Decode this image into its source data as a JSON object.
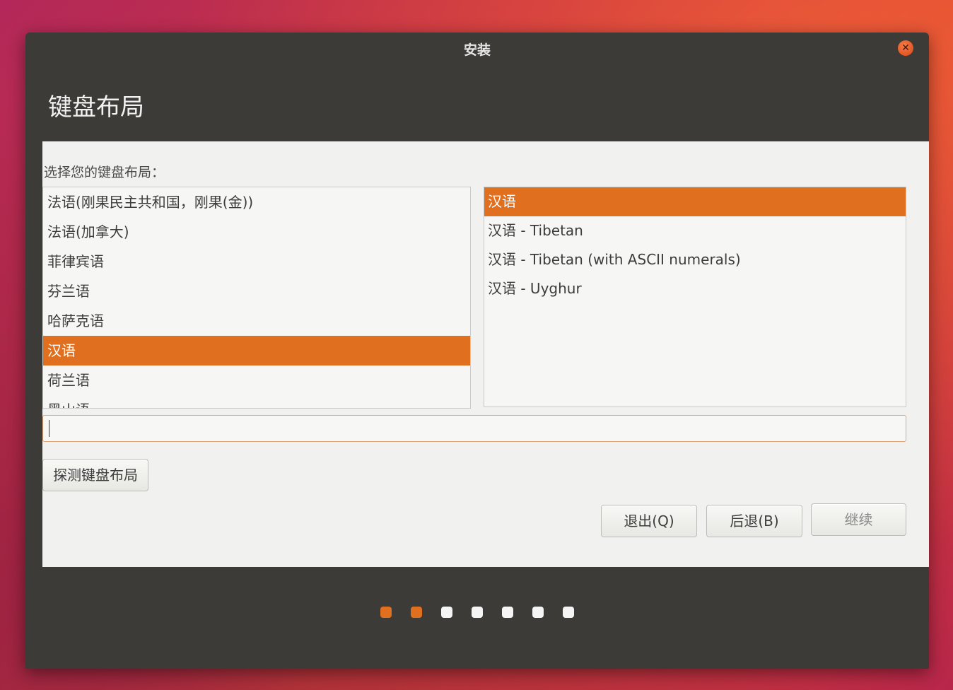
{
  "window": {
    "title": "安装",
    "close_icon": "close-icon"
  },
  "page": {
    "title": "键盘布局",
    "prompt": "选择您的键盘布局："
  },
  "layouts": [
    {
      "label": "法语(刚果民主共和国，刚果(金))",
      "selected": false
    },
    {
      "label": "法语(加拿大)",
      "selected": false
    },
    {
      "label": "菲律宾语",
      "selected": false
    },
    {
      "label": "芬兰语",
      "selected": false
    },
    {
      "label": "哈萨克语",
      "selected": false
    },
    {
      "label": "汉语",
      "selected": true
    },
    {
      "label": "荷兰语",
      "selected": false
    },
    {
      "label": "黑山语",
      "selected": false
    }
  ],
  "variants": [
    {
      "label": "汉语",
      "selected": true
    },
    {
      "label": "汉语 - Tibetan",
      "selected": false
    },
    {
      "label": "汉语 - Tibetan (with ASCII numerals)",
      "selected": false
    },
    {
      "label": "汉语 - Uyghur",
      "selected": false
    }
  ],
  "test_input": {
    "value": "",
    "placeholder": ""
  },
  "buttons": {
    "detect": "探测键盘布局",
    "quit": "退出(Q)",
    "back": "后退(B)",
    "continue": "继续"
  },
  "progress": {
    "total_steps": 7,
    "completed_steps": 2
  },
  "colors": {
    "accent": "#e0701f",
    "window_dark": "#3c3b37",
    "content_bg": "#f1f1ef"
  }
}
